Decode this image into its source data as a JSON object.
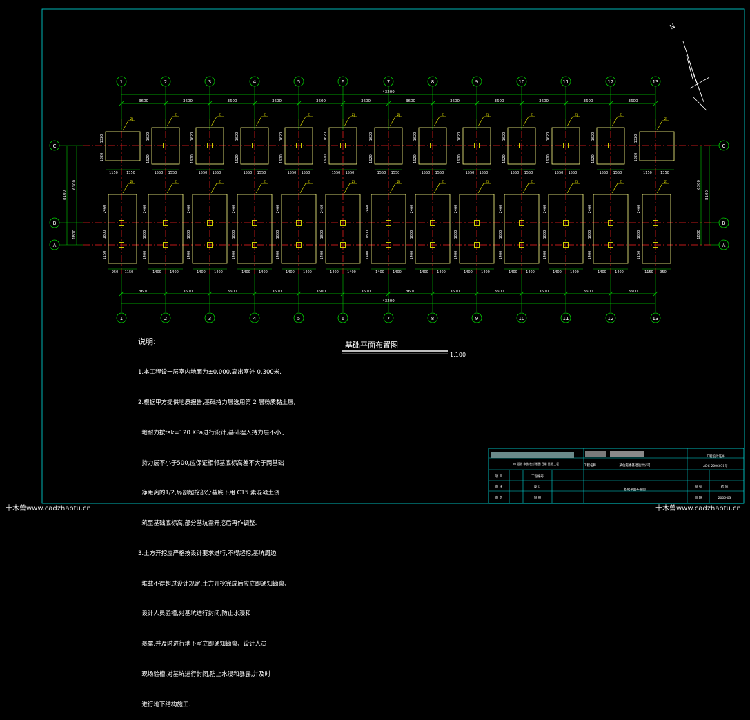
{
  "drawing": {
    "colors": {
      "background": "#000000",
      "frame": "#00e0e0",
      "dimension": "#00d000",
      "axis": "#ff2020",
      "footing": "#ffff88",
      "tag": "#e6e600",
      "column": "#ffff00",
      "text": "#ffffff"
    },
    "column_labels": [
      "1",
      "2",
      "3",
      "4",
      "5",
      "6",
      "7",
      "8",
      "9",
      "10",
      "11",
      "12",
      "13"
    ],
    "row_labels": [
      "C",
      "B",
      "A"
    ],
    "dims": {
      "bay": "3600",
      "overall": "43200",
      "top_widths_mid": [
        "1550",
        "1550"
      ],
      "top_widths_end_left": [
        "1150",
        "1350"
      ],
      "top_widths_end_right": [
        "1150",
        "1350"
      ],
      "top_height": "1620",
      "top_height_end": "1320",
      "bot_widths_mid": [
        "1400",
        "1400"
      ],
      "bot_widths_end_left": [
        "950",
        "1150"
      ],
      "bot_widths_end_right": [
        "1150",
        "950"
      ],
      "bot_heights": [
        "2460",
        "1800",
        "1400"
      ],
      "bot_heights_end": [
        "2460",
        "1800",
        "1150"
      ],
      "right_dims": [
        "6300",
        "8100",
        "1800"
      ],
      "left_dims": [
        "8100",
        "6300",
        "1800"
      ]
    },
    "tag": "ZJ",
    "north": "N"
  },
  "notes": {
    "title": "说明:",
    "lines": [
      "1.本工程设一层室内地面为±0.000,高出室外 0.300米.",
      "2.根据甲方提供地质报告,基础持力层选用第 2 层粉质黏土层,",
      "  地耐力按fak=120 KPa进行设计,基础埋入持力层不小于",
      "  持力层不小于500,应保证相邻基底标高差不大于两基础",
      "  净距离的1/2,局部超挖部分基底下用 C15 素混凝土浇",
      "  筑至基础底标高,部分基坑需开挖后再作调整.",
      "3.土方开挖应严格按设计要求进行,不得超挖,基坑周边",
      "  堆载不得超过设计规定.土方开挖完成后应立即通知勘察、",
      "  设计人员验槽,对基坑进行封闭,防止水浸和",
      "  暴露,并及时进行地下室立即通知勘察、设计人员",
      "  现场验槽,对基坑进行封闭,防止水浸和暴露,并及时",
      "  进行地下结构施工."
    ]
  },
  "plan": {
    "title": "基础平面布置图",
    "scale": "1:100"
  },
  "title_block": {
    "row1_right": "工程设计证书",
    "row2_left": "MI 设计 审核 校对 制图 日期 日期 工程",
    "row2_mid": "工程名称",
    "row2_right": "某住宅楼基础设计公司",
    "row2_far": "ADC-2006078号",
    "row3_a": "项 目",
    "row3_b": "工程编号",
    "row4_a": "审 核",
    "row4_b": "设 计",
    "row4_c": "图 号",
    "row4_d": "结 施",
    "row5_a": "审 定",
    "row5_b": "制 图",
    "row5_c": "基础平面布置图",
    "row5_d": "日 期",
    "row5_e": "2006-03"
  },
  "watermarks": {
    "left": "十木兽www.cadzhaotu.cn",
    "right": "十木兽www.cadzhaotu.cn"
  }
}
